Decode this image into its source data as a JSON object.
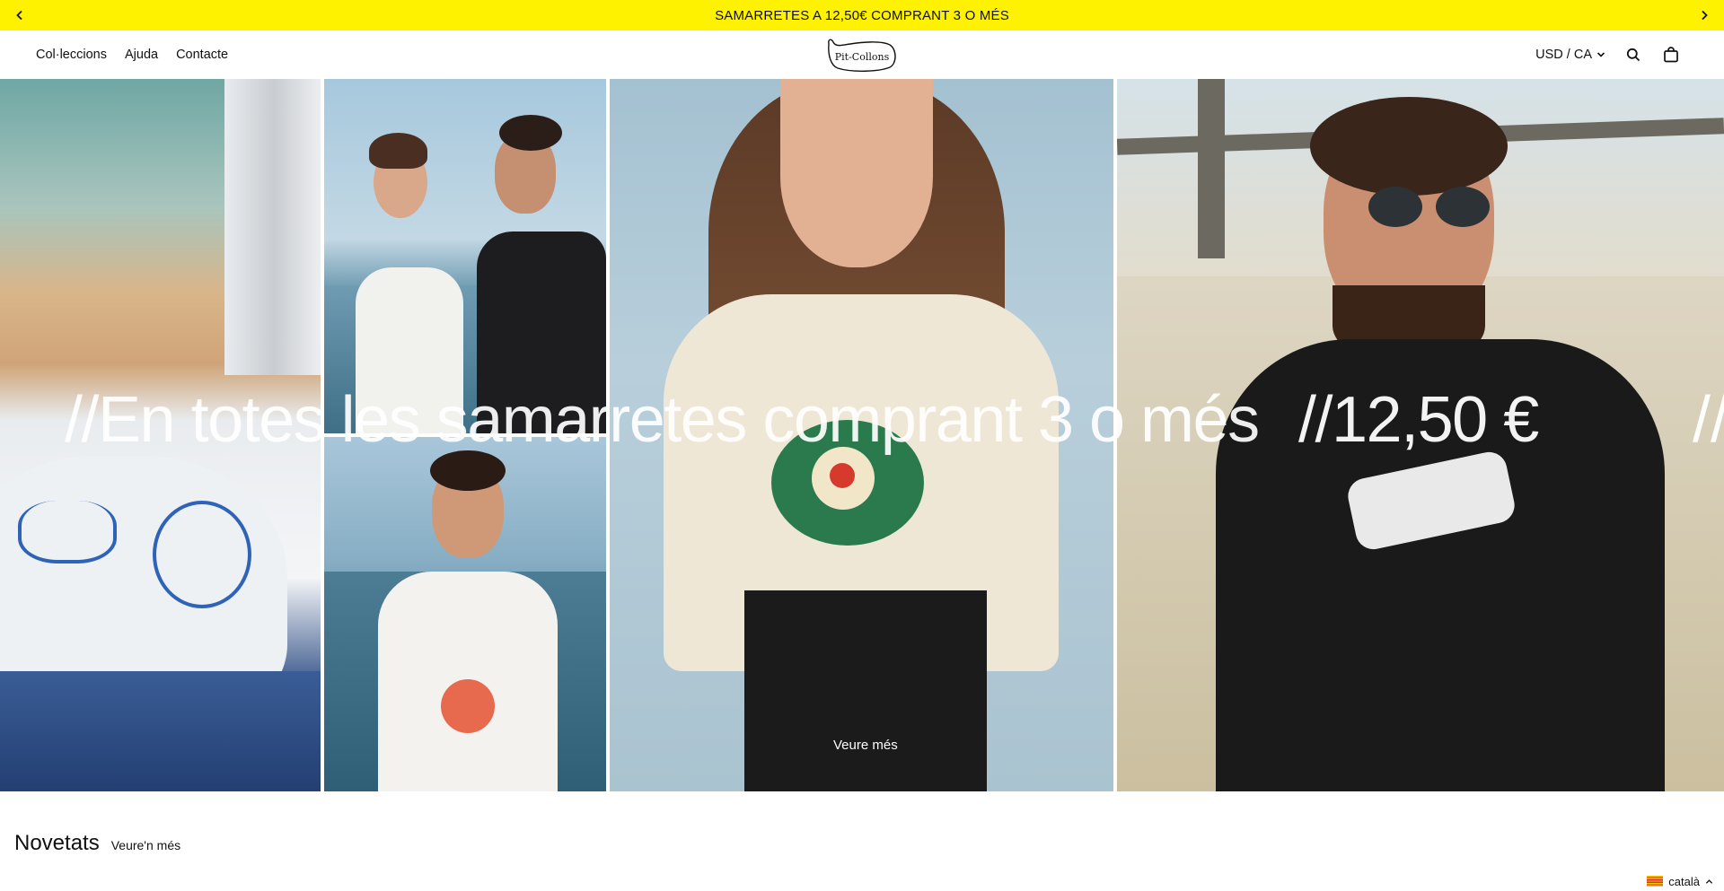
{
  "announcement": {
    "text": "SAMARRETES A 12,50€ COMPRANT 3 O MÉS",
    "prev_icon": "chevron-left-icon",
    "next_icon": "chevron-right-icon"
  },
  "header": {
    "nav": [
      "Col·leccions",
      "Ajuda",
      "Contacte"
    ],
    "logo_text": "Pit-Collons",
    "currency": "USD / CA",
    "icons": [
      "search-icon",
      "bag-icon"
    ]
  },
  "hero": {
    "marquee_text": "//En totes les samarretes comprant 3 o més",
    "marquee_price": "//12,50 €",
    "marquee_tail": "//",
    "cta": "Veure més"
  },
  "section": {
    "title": "Novetats",
    "link": "Veure'n més"
  },
  "language": {
    "label": "català"
  },
  "colors": {
    "announcement_bg": "#fff200",
    "text": "#111111",
    "hero_text": "#ffffff"
  }
}
